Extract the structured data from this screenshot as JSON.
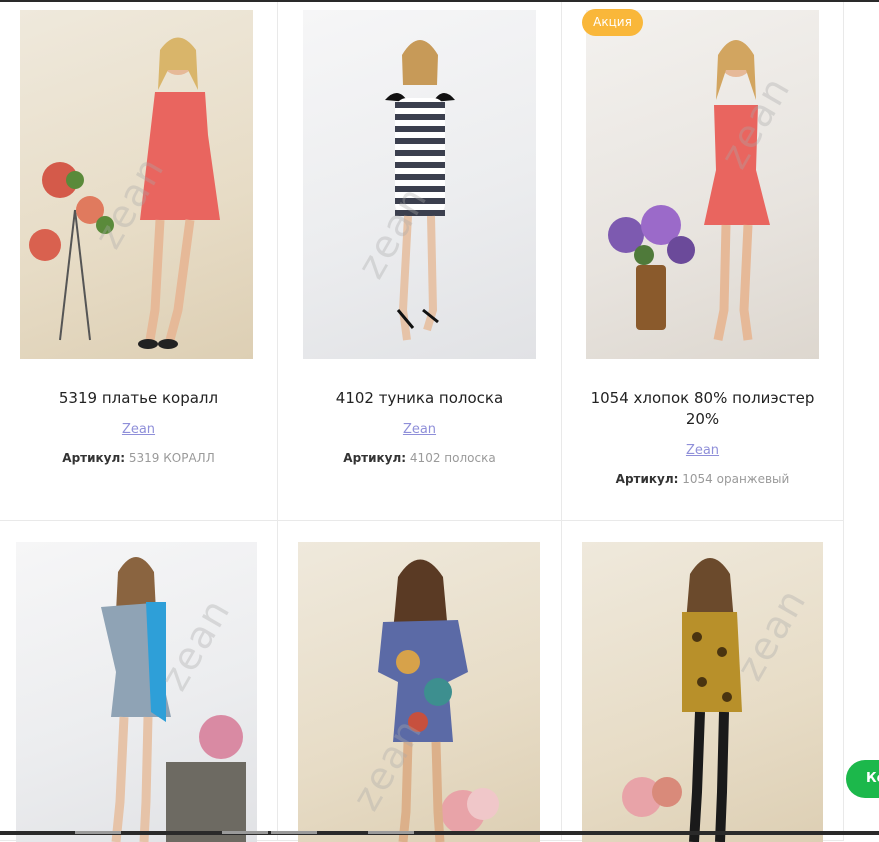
{
  "products": [
    {
      "title": "5319 платье коралл",
      "brand": "Zean",
      "sku_label": "Артикул:",
      "sku_value": "5319 КОРАЛЛ"
    },
    {
      "title": "4102 туника полоска",
      "brand": "Zean",
      "sku_label": "Артикул:",
      "sku_value": "4102 полоска"
    },
    {
      "title": "1054 хлопок 80% полиэстер 20%",
      "brand": "Zean",
      "sku_label": "Артикул:",
      "sku_value": "1054 оранжевый",
      "badge": "Акция"
    },
    {
      "title": "",
      "brand": "",
      "sku_label": "",
      "sku_value": ""
    },
    {
      "title": "",
      "brand": "",
      "sku_label": "",
      "sku_value": ""
    },
    {
      "title": "",
      "brand": "",
      "sku_label": "",
      "sku_value": ""
    }
  ],
  "watermark_text": "zean",
  "chat_button_label": "Ко",
  "colors": {
    "badge": "#f9b73a",
    "brand_link": "#8f8fd9",
    "chat_button": "#1cb84b",
    "coral_dress": "#e9655f"
  }
}
